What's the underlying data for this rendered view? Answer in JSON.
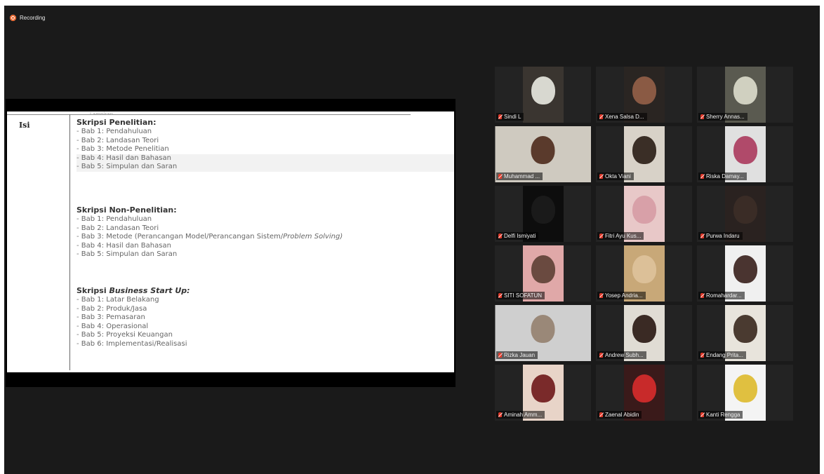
{
  "recording": {
    "label": "Recording",
    "color": "#e8632a"
  },
  "slide": {
    "top_fragment": "Lampiran",
    "row_label": "Isi",
    "sections": [
      {
        "title": "Skripsi Penelitian:",
        "items": [
          "Bab 1: Pendahuluan",
          "Bab 2: Landasan Teori",
          "Bab 3: Metode Penelitian",
          "Bab 4: Hasil dan Bahasan",
          "Bab 5: Simpulan dan Saran"
        ]
      },
      {
        "title": "Skripsi Non-Penelitian:",
        "items": [
          "Bab 1: Pendahuluan",
          "Bab 2: Landasan Teori",
          "Bab 3: Metode (Perancangan Model/Perancangan Sistem/",
          "Bab 4: Hasil dan Bahasan",
          "Bab 5: Simpulan dan Saran"
        ],
        "item3_italic": "Problem Solving)"
      },
      {
        "title_prefix": "Skripsi ",
        "title_italic": "Business Start Up:",
        "items": [
          "Bab 1: Latar Belakang",
          "Bab 2: Produk/Jasa",
          "Bab 3: Pemasaran",
          "Bab 4: Operasional",
          "Bab 5: Proyeksi Keuangan",
          "Bab 6: Implementasi/Realisasi"
        ]
      }
    ]
  },
  "participants": [
    {
      "name": "Sindi L",
      "video": "#3a3530",
      "head": "#d8d8d0"
    },
    {
      "name": "Xena Salsa D...",
      "video": "#2a2522",
      "head": "#8a5a44"
    },
    {
      "name": "Sherry Annas...",
      "video": "#5a5a50",
      "head": "#d0d0c0"
    },
    {
      "name": "Muhammad ...",
      "video": "#cfcac0",
      "head": "#5a3a2c"
    },
    {
      "name": "Okta Viani",
      "video": "#d8d2c8",
      "head": "#3a2e26"
    },
    {
      "name": "Riska Damay...",
      "video": "#e0e0e0",
      "head": "#b04a6a"
    },
    {
      "name": "Delfi Ismiyati",
      "video": "#0d0d0d",
      "head": "#1a1a1a"
    },
    {
      "name": "Fitri Ayu Kus...",
      "video": "#e8c8c8",
      "head": "#d8a0a8"
    },
    {
      "name": "Purwa Indaru",
      "video": "#2a2220",
      "head": "#3a2c26"
    },
    {
      "name": "SITI SOFATUN",
      "video": "#e0a8a8",
      "head": "#6a4a40"
    },
    {
      "name": "Yosep Andria...",
      "video": "#c8a878",
      "head": "#dcc098"
    },
    {
      "name": "Romahardar...",
      "video": "#f0f0f0",
      "head": "#4a3430"
    },
    {
      "name": "Rizka Jauan",
      "video": "#cfcfcf",
      "head": "#9a8878"
    },
    {
      "name": "Andrew Subh...",
      "video": "#e0dcd4",
      "head": "#3a2a24"
    },
    {
      "name": "Endang Prita...",
      "video": "#e8e4dc",
      "head": "#4a3a30"
    },
    {
      "name": "Aminah Amm...",
      "video": "#e8d4c8",
      "head": "#7a2a2a"
    },
    {
      "name": "Zaenal Abidin",
      "video": "#3a1a1a",
      "head": "#c82a2a"
    },
    {
      "name": "Kanti Rengga",
      "video": "#f4f4f4",
      "head": "#e0c040"
    }
  ]
}
